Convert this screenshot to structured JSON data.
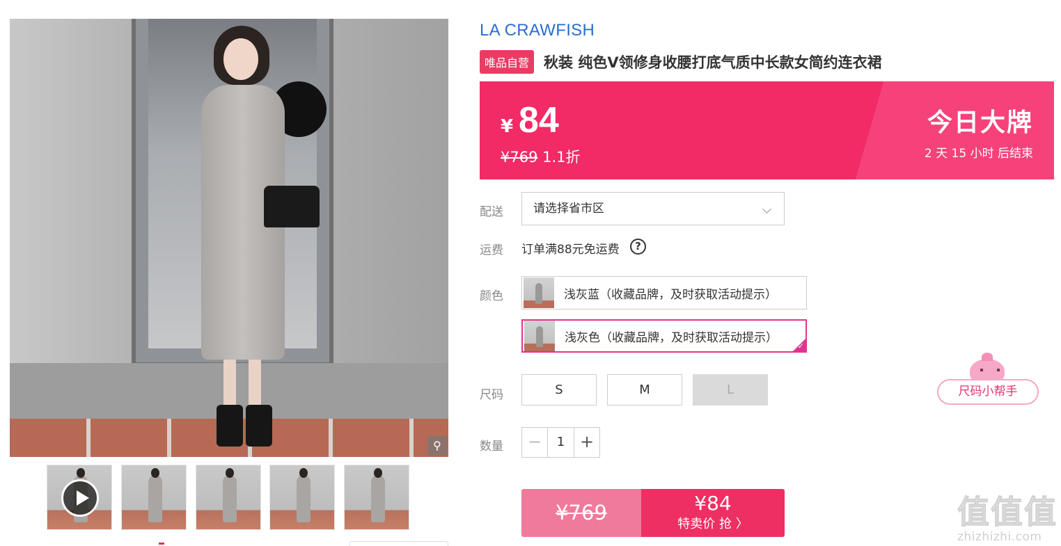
{
  "gallery": {
    "main_image_alt": "",
    "thumb_count": 5
  },
  "product": {
    "brand": "LA CRAWFISH",
    "badge": "唯品自营",
    "title": "秋装 纯色V领修身收腰打底气质中长款女简约连衣裙"
  },
  "price_banner": {
    "currency": "¥",
    "price": "84",
    "original_price": "¥769",
    "discount": "1.1折",
    "promo_title": "今日大牌",
    "countdown": "2 天 15 小时 后结束"
  },
  "delivery": {
    "label": "配送",
    "placeholder": "请选择省市区"
  },
  "shipping": {
    "label": "运费",
    "text": "订单满88元免运费"
  },
  "color": {
    "label": "颜色",
    "options": [
      {
        "text": "浅灰蓝（收藏品牌，及时获取活动提示）",
        "selected": false
      },
      {
        "text": "浅灰色（收藏品牌，及时获取活动提示）",
        "selected": true
      }
    ]
  },
  "size": {
    "label": "尺码",
    "options": [
      {
        "text": "S",
        "disabled": false
      },
      {
        "text": "M",
        "disabled": false
      },
      {
        "text": "L",
        "disabled": true
      }
    ],
    "helper": "尺码小帮手"
  },
  "quantity": {
    "label": "数量",
    "minus": "−",
    "value": "1",
    "plus": "+"
  },
  "buy": {
    "original": "¥769",
    "price": "¥84",
    "label": "特卖价 抢 〉"
  },
  "watermark": {
    "big": "值值值",
    "small": "zhizhizhi.com"
  },
  "colors": {
    "accent": "#f22a65",
    "brand_link": "#2b6dd1",
    "selected_border": "#e0358e"
  }
}
